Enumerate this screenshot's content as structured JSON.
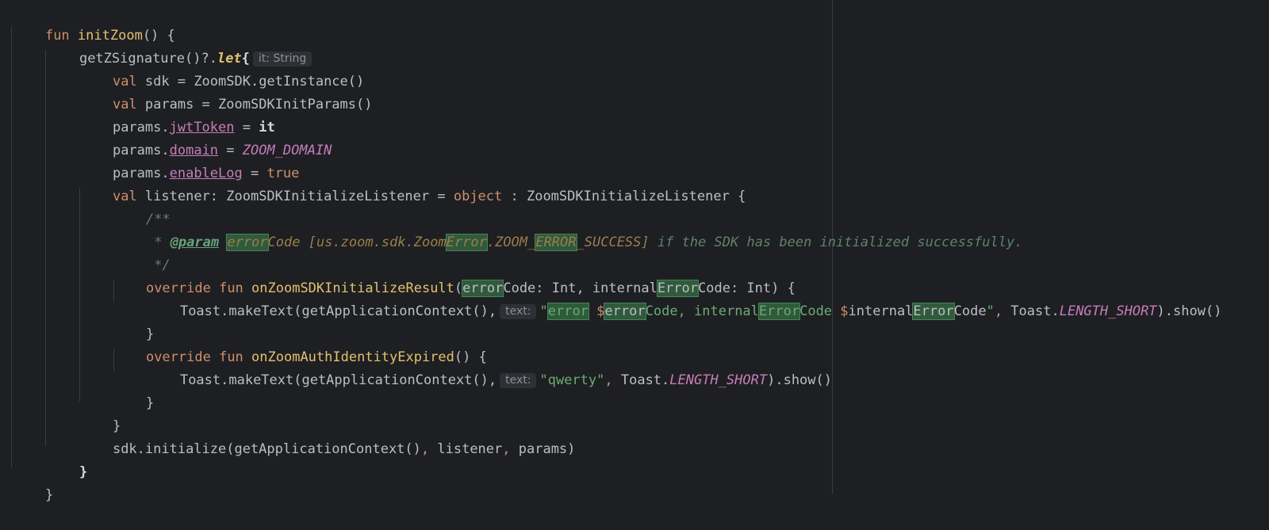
{
  "hints": {
    "it_type": "it: String",
    "text_param": "text:"
  },
  "code": {
    "l1_fun": "fun",
    "l1_name": "initZoom",
    "l1_rest": "() {",
    "l2_a": "getZSignature()?.",
    "l2_let": "let",
    "l2_brace": "{",
    "l3_val": "val",
    "l3_rest": " sdk = ZoomSDK.getInstance()",
    "l4_val": "val",
    "l4_rest": " params = ZoomSDKInitParams()",
    "l5_a": "params.",
    "l5_prop": "jwtToken",
    "l5_b": " = ",
    "l5_it": "it",
    "l6_a": "params.",
    "l6_prop": "domain",
    "l6_b": " = ",
    "l6_const": "ZOOM_DOMAIN",
    "l7_a": "params.",
    "l7_prop": "enableLog",
    "l7_b": " = ",
    "l7_true": "true",
    "l8_val": "val",
    "l8_a": " listener: ZoomSDKInitializeListener = ",
    "l8_object": "object",
    "l8_b": " : ZoomSDKInitializeListener {",
    "l9": "/**",
    "l10_star": " * ",
    "l10_tag": "@param",
    "l10_sp": " ",
    "l10_err1": "error",
    "l10_code": "Code",
    "l10_ref1": " [us.zoom.sdk.Zoom",
    "l10_err2": "Error",
    "l10_ref2": ".ZOOM_",
    "l10_err3": "ERROR",
    "l10_ref3": "_SUCCESS]",
    "l10_tail": " if the SDK has been initialized successfully.",
    "l11": " */",
    "l12_override": "override",
    "l12_fun": " fun ",
    "l12_name": "onZoomSDKInitializeResult",
    "l12_p": "(",
    "l12_err1": "error",
    "l12_a": "Code: Int, internal",
    "l12_err2": "Error",
    "l12_b": "Code: Int) {",
    "l13_a": "Toast.makeText(getApplicationContext(),",
    "l13_q": "\"",
    "l13_err1": "error",
    "l13_sp": " ",
    "l13_d1": "$",
    "l13_err2": "error",
    "l13_c1": "Code, internal",
    "l13_err3": "Error",
    "l13_c2": "Code ",
    "l13_d2": "$",
    "l13_int": "internal",
    "l13_err4": "Error",
    "l13_c3": "Code",
    "l13_q2": "\"",
    "l13_comma": ",",
    "l13_b": " Toast.",
    "l13_const": "LENGTH_SHORT",
    "l13_c": ").show()",
    "l14": "}",
    "l15_override": "override",
    "l15_fun": " fun ",
    "l15_name": "onZoomAuthIdentityExpired",
    "l15_rest": "() {",
    "l16_a": "Toast.makeText(getApplicationContext(),",
    "l16_str": "\"qwerty\"",
    "l16_comma": ",",
    "l16_b": " Toast.",
    "l16_const": "LENGTH_SHORT",
    "l16_c": ").show()",
    "l17": "}",
    "l18": "}",
    "l19_a": "sdk.initialize(getApplicationContext()",
    "l19_c1": ",",
    "l19_b": " listener",
    "l19_c2": ",",
    "l19_d": " params)",
    "l20": "}",
    "l21": "}"
  },
  "colors": {
    "background": "#1e1f22",
    "keyword": "#cf8e6d",
    "function_decl": "#e2c16f",
    "property": "#c77dbb",
    "string": "#6aab73",
    "doc_comment": "#5f826b",
    "highlight": "#2f5a3b"
  }
}
